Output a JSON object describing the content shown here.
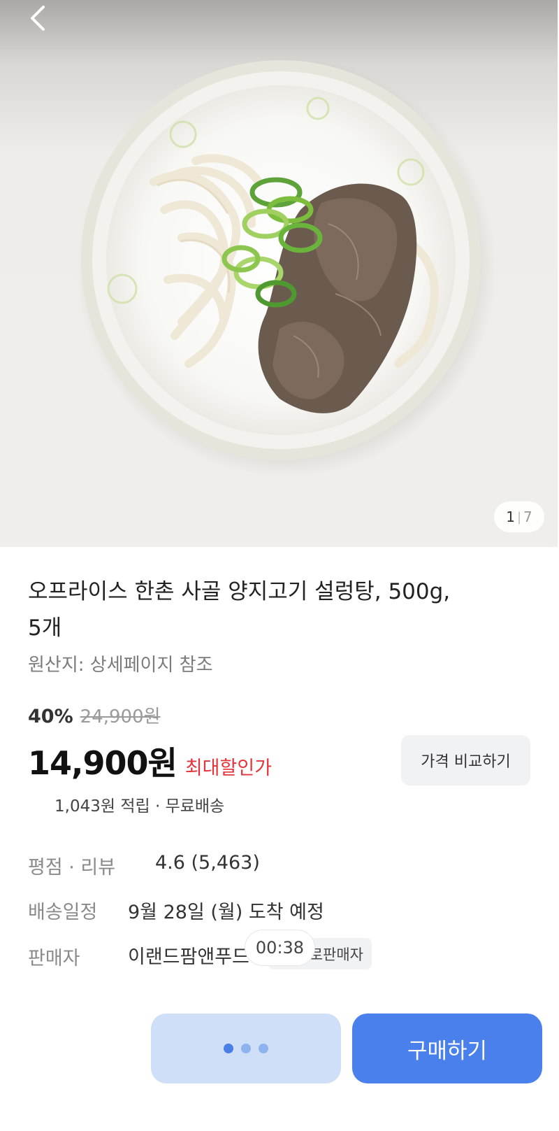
{
  "image_gallery": {
    "current": "1",
    "separator": "|",
    "total": "7"
  },
  "product": {
    "title_line1": "오프라이스 한촌 사골 양지고기 설렁탕, 500g,",
    "title_line2": "5개",
    "origin": "원산지: 상세페이지 참조",
    "discount_percent": "40%",
    "original_price": "24,900원",
    "price": "14,900원",
    "price_tag": "최대할인가",
    "compare_button": "가격 비교하기",
    "reward": "1,043원 적립 · 무료배송"
  },
  "info": {
    "rating_label": "평점 · 리뷰",
    "rating_value": "4.6 (5,463)",
    "delivery_label": "배송일정",
    "delivery_value": "9월 28일 (월) 도착 예정",
    "seller_label": "판매자",
    "seller_value": "이랜드팜앤푸드",
    "seller_badge": "로판매자"
  },
  "overlay": {
    "timer": "00:38"
  },
  "actions": {
    "buy_label": "구매하기",
    "loading_active_dot": 1
  },
  "colors": {
    "price_tag": "#e5333b",
    "primary_button": "#4a80ec",
    "loading_button": "#cfdff8"
  },
  "icons": {
    "back": "chevron-left-icon"
  }
}
